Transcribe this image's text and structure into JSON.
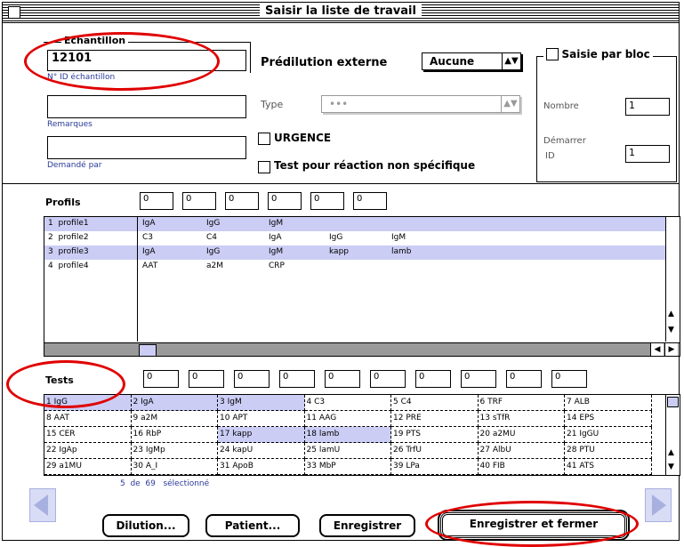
{
  "window": {
    "title": "Saisir la liste de travail"
  },
  "echantillon": {
    "group_label": "Echantillon",
    "value": "12101",
    "id_label": "N° ID échantillon",
    "remarques_label": "Remarques",
    "demande_label": "Demandé par"
  },
  "predilution": {
    "label": "Prédilution externe",
    "value": "Aucune"
  },
  "type": {
    "label": "Type",
    "value": "•••"
  },
  "urgence_label": "URGENCE",
  "nonspec_label": "Test pour réaction non spécifique",
  "saisie_bloc": {
    "label": "Saisie par bloc",
    "nombre_label": "Nombre",
    "nombre_value": "1",
    "demarrer_label_1": "Démarrer",
    "demarrer_label_2": "ID",
    "demarrer_value": "1"
  },
  "profils": {
    "label": "Profils",
    "inputs": [
      "0",
      "0",
      "0",
      "0",
      "0",
      "0"
    ],
    "rows": [
      {
        "name": "1  profile1",
        "items": [
          "IgA",
          "IgG",
          "IgM",
          "",
          ""
        ],
        "selected": true
      },
      {
        "name": "2  profile2",
        "items": [
          "C3",
          "C4",
          "IgA",
          "IgG",
          "IgM"
        ],
        "selected": false
      },
      {
        "name": "3  profile3",
        "items": [
          "IgA",
          "IgG",
          "IgM",
          "kapp",
          "lamb"
        ],
        "selected": true
      },
      {
        "name": "4  profile4",
        "items": [
          "AAT",
          "a2M",
          "CRP",
          "",
          ""
        ],
        "selected": false
      }
    ]
  },
  "tests": {
    "label": "Tests",
    "inputs": [
      "0",
      "0",
      "0",
      "0",
      "0",
      "0",
      "0",
      "0",
      "0",
      "0"
    ],
    "grid": [
      [
        "1 IgG",
        "2 IgA",
        "3 IgM",
        "4 C3",
        "5 C4",
        "6 TRF",
        "7 ALB"
      ],
      [
        "8 AAT",
        "9 a2M",
        "10 APT",
        "11 AAG",
        "12 PRE",
        "13 sTfR",
        "14 EPS"
      ],
      [
        "15 CER",
        "16 RbP",
        "17 kapp",
        "18 lamb",
        "19 PTS",
        "20 a2MU",
        "21 IgGU"
      ],
      [
        "22 IgAp",
        "23 IgMp",
        "24 kapU",
        "25 lamU",
        "26 TrfU",
        "27 AlbU",
        "28 PTU"
      ],
      [
        "29 a1MU",
        "30 A_I",
        "31 ApoB",
        "33 MbP",
        "39 LPa",
        "40 FIB",
        "41 ATS"
      ]
    ],
    "selected": [
      [
        0,
        0
      ],
      [
        0,
        1
      ],
      [
        0,
        2
      ],
      [
        2,
        2
      ],
      [
        2,
        3
      ]
    ],
    "status": "5  de  69   sélectionné"
  },
  "buttons": {
    "dilution": "Dilution...",
    "patient": "Patient...",
    "enregistrer": "Enregistrer",
    "enregistrer_fermer": "Enregistrer et fermer"
  }
}
